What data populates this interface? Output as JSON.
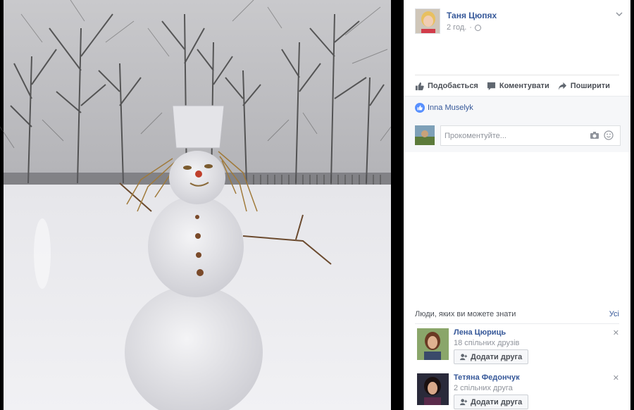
{
  "post": {
    "author": "Таня Цюпях",
    "time": "2 год.",
    "privacy_icon": "globe-icon"
  },
  "actions": {
    "like": "Подобається",
    "comment": "Коментувати",
    "share": "Поширити"
  },
  "likes": {
    "names": "Inna Muselyk"
  },
  "comment_box": {
    "placeholder": "Прокоментуйте..."
  },
  "pymk": {
    "title": "Люди, яких ви можете знати",
    "see_all": "Усі",
    "people": [
      {
        "name": "Лена Цюриць",
        "mutual": "18 спільних друзів",
        "add": "Додати друга"
      },
      {
        "name": "Тетяна Федончук",
        "mutual": "2 спільних друга",
        "add": "Додати друга"
      }
    ]
  },
  "colors": {
    "link": "#365899",
    "muted": "#90949c",
    "like_badge": "#5890ff"
  }
}
